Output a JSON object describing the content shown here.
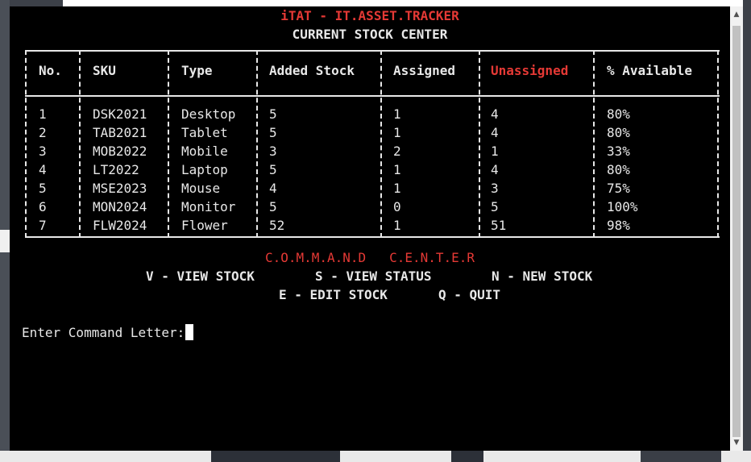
{
  "app": {
    "title": "iTAT - IT.ASSET.TRACKER",
    "subtitle": "CURRENT STOCK CENTER"
  },
  "table": {
    "headers": [
      "No.",
      "SKU",
      "Type",
      "Added Stock",
      "Assigned",
      "Unassigned",
      "% Available"
    ],
    "rows": [
      [
        "1",
        "DSK2021",
        "Desktop",
        "5",
        "1",
        "4",
        "80%"
      ],
      [
        "2",
        "TAB2021",
        "Tablet",
        "5",
        "1",
        "4",
        "80%"
      ],
      [
        "3",
        "MOB2022",
        "Mobile",
        "3",
        "2",
        "1",
        "33%"
      ],
      [
        "4",
        "LT2022",
        "Laptop",
        "5",
        "1",
        "4",
        "80%"
      ],
      [
        "5",
        "MSE2023",
        "Mouse",
        "4",
        "1",
        "3",
        "75%"
      ],
      [
        "6",
        "MON2024",
        "Monitor",
        "5",
        "0",
        "5",
        "100%"
      ],
      [
        "7",
        "FLW2024",
        "Flower",
        "52",
        "1",
        "51",
        "98%"
      ]
    ]
  },
  "commands": {
    "title": "C.O.M.M.A.N.D   C.E.N.T.E.R",
    "view_stock": "V - VIEW STOCK",
    "view_status": "S - VIEW STATUS",
    "new_stock": "N - NEW STOCK",
    "edit_stock": "E - EDIT STOCK",
    "quit": "Q - QUIT"
  },
  "prompt": {
    "label": "Enter Command Letter:"
  },
  "colors": {
    "accent_red": "#e53935",
    "terminal_bg": "#000000",
    "terminal_fg": "#e8e8e8"
  }
}
